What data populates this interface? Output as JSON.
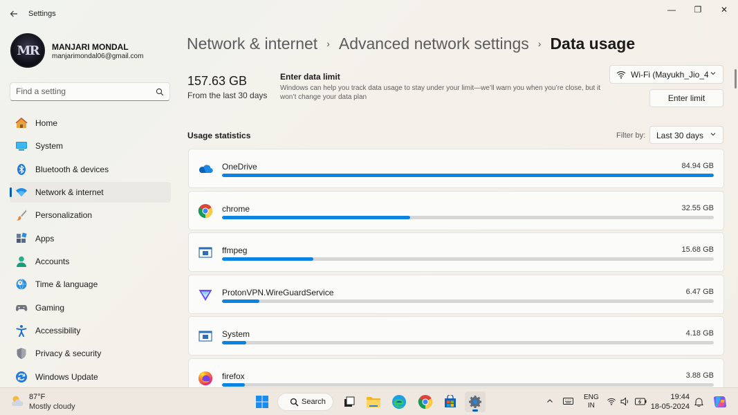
{
  "window": {
    "title": "Settings",
    "minimize_glyph": "—",
    "maximize_glyph": "❐",
    "close_glyph": "✕"
  },
  "profile": {
    "name": "MANJARI MONDAL",
    "email": "manjarimondal06@gmail.com",
    "avatar_initials": "MR"
  },
  "search": {
    "placeholder": "Find a setting"
  },
  "nav": {
    "items": [
      {
        "label": "Home",
        "icon": "home-icon"
      },
      {
        "label": "System",
        "icon": "system-icon"
      },
      {
        "label": "Bluetooth & devices",
        "icon": "bluetooth-icon"
      },
      {
        "label": "Network & internet",
        "icon": "network-icon",
        "active": true
      },
      {
        "label": "Personalization",
        "icon": "brush-icon"
      },
      {
        "label": "Apps",
        "icon": "apps-icon"
      },
      {
        "label": "Accounts",
        "icon": "accounts-icon"
      },
      {
        "label": "Time & language",
        "icon": "globe-clock-icon"
      },
      {
        "label": "Gaming",
        "icon": "gamepad-icon"
      },
      {
        "label": "Accessibility",
        "icon": "accessibility-icon"
      },
      {
        "label": "Privacy & security",
        "icon": "shield-icon"
      },
      {
        "label": "Windows Update",
        "icon": "update-icon"
      }
    ]
  },
  "breadcrumb": {
    "items": [
      "Network & internet",
      "Advanced network settings"
    ],
    "current": "Data usage",
    "separator": "›"
  },
  "summary": {
    "total": "157.63 GB",
    "period": "From the last 30 days"
  },
  "data_limit": {
    "title": "Enter data limit",
    "description": "Windows can help you track data usage to stay under your limit—we’ll warn you when you’re close, but it won’t change your data plan",
    "button_label": "Enter limit"
  },
  "network_select": {
    "value": "Wi-Fi (Mayukh_Jio_4"
  },
  "usage": {
    "title": "Usage statistics",
    "filter_label": "Filter by:",
    "filter_value": "Last 30 days",
    "apps": [
      {
        "name": "OneDrive",
        "size": "84.94 GB",
        "share": 1.0,
        "icon": "onedrive-icon"
      },
      {
        "name": "chrome",
        "size": "32.55 GB",
        "share": 0.383,
        "icon": "chrome-icon"
      },
      {
        "name": "ffmpeg",
        "size": "15.68 GB",
        "share": 0.185,
        "icon": "app-window-icon"
      },
      {
        "name": "ProtonVPN.WireGuardService",
        "size": "6.47 GB",
        "share": 0.076,
        "icon": "protonvpn-icon"
      },
      {
        "name": "System",
        "size": "4.18 GB",
        "share": 0.049,
        "icon": "app-window-icon"
      },
      {
        "name": "firefox",
        "size": "3.88 GB",
        "share": 0.046,
        "icon": "firefox-icon"
      }
    ]
  },
  "taskbar": {
    "weather_temp": "87°F",
    "weather_desc": "Mostly cloudy",
    "search_label": "Search",
    "lang_line1": "ENG",
    "lang_line2": "IN",
    "time": "19:44",
    "date": "18-05-2024"
  },
  "colors": {
    "accent": "#005fb8",
    "bar_fill": "#0a84e0",
    "bar_track": "#d6d6d6"
  }
}
